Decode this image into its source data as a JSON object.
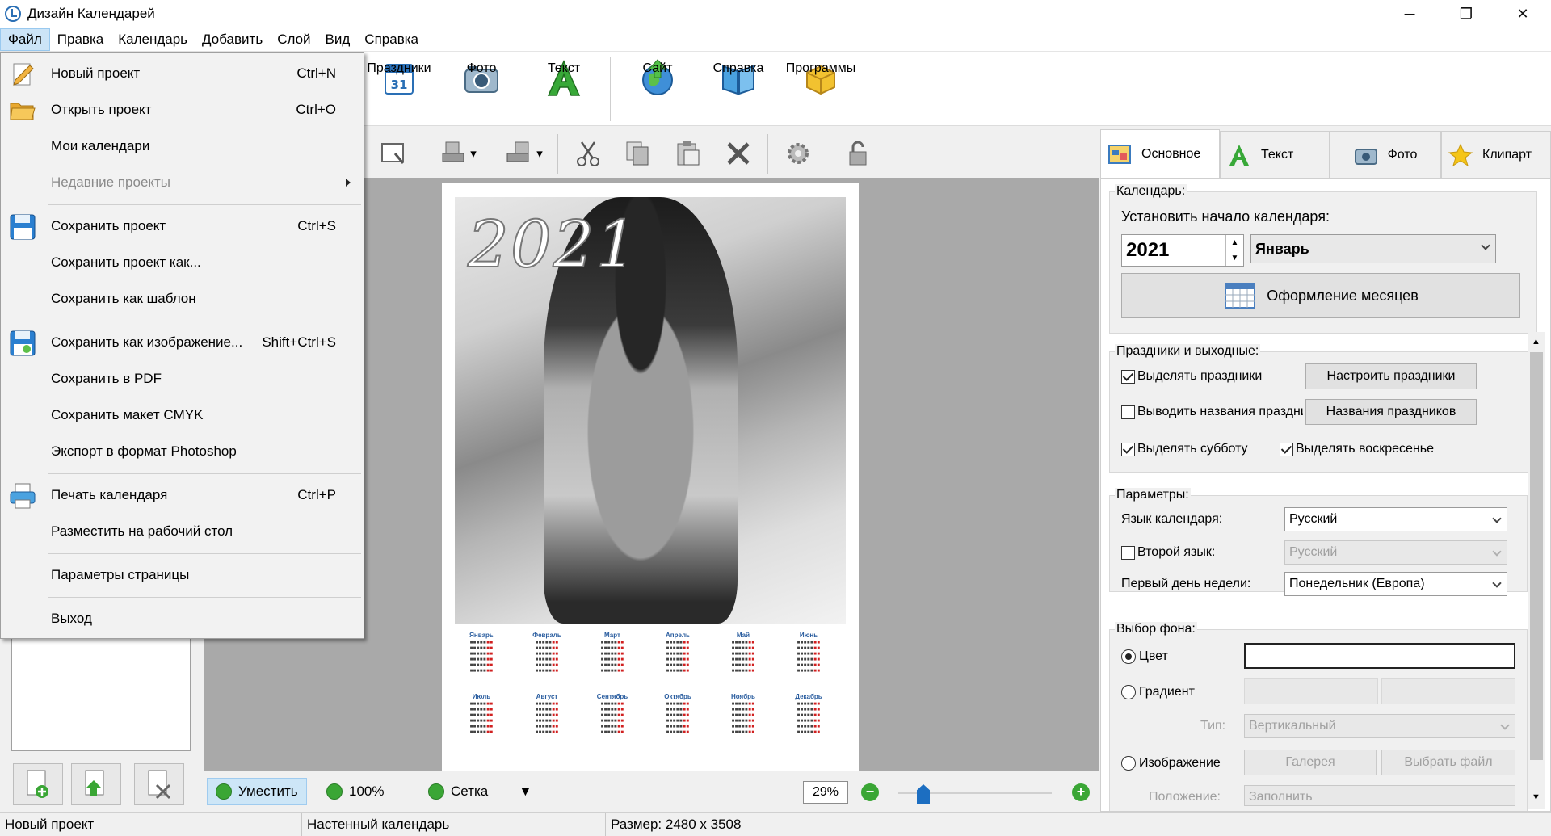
{
  "window": {
    "title": "Дизайн Календарей"
  },
  "menubar": [
    {
      "label": "Файл"
    },
    {
      "label": "Правка"
    },
    {
      "label": "Календарь"
    },
    {
      "label": "Добавить"
    },
    {
      "label": "Слой"
    },
    {
      "label": "Вид"
    },
    {
      "label": "Справка"
    }
  ],
  "toolbar": {
    "holidays": "Праздники",
    "photo": "Фото",
    "text": "Текст",
    "site": "Сайт",
    "help": "Справка",
    "programs": "Программы"
  },
  "file_menu": [
    {
      "label": "Новый проект",
      "shortcut": "Ctrl+N"
    },
    {
      "label": "Открыть проект",
      "shortcut": "Ctrl+O"
    },
    {
      "label": "Мои календари",
      "shortcut": ""
    },
    {
      "label": "Недавние проекты",
      "shortcut": ""
    },
    {
      "label": "Сохранить проект",
      "shortcut": "Ctrl+S"
    },
    {
      "label": "Сохранить проект как...",
      "shortcut": ""
    },
    {
      "label": "Сохранить как шаблон",
      "shortcut": ""
    },
    {
      "label": "Сохранить как изображение...",
      "shortcut": "Shift+Ctrl+S"
    },
    {
      "label": "Сохранить в PDF",
      "shortcut": ""
    },
    {
      "label": "Сохранить макет CMYK",
      "shortcut": ""
    },
    {
      "label": "Экспорт в формат Photoshop",
      "shortcut": ""
    },
    {
      "label": "Печать календаря",
      "shortcut": "Ctrl+P"
    },
    {
      "label": "Разместить на рабочий стол",
      "shortcut": ""
    },
    {
      "label": "Параметры страницы",
      "shortcut": ""
    },
    {
      "label": "Выход",
      "shortcut": ""
    }
  ],
  "canvas": {
    "year": "2021",
    "months": [
      "Январь",
      "Февраль",
      "Март",
      "Апрель",
      "Май",
      "Июнь",
      "Июль",
      "Август",
      "Сентябрь",
      "Октябрь",
      "Ноябрь",
      "Декабрь"
    ]
  },
  "bottom": {
    "fit": "Уместить",
    "hundred": "100%",
    "grid": "Сетка",
    "zoom": "29%"
  },
  "status": {
    "project": "Новый проект",
    "type": "Настенный календарь",
    "size": "Размер: 2480 x 3508"
  },
  "right_tabs": [
    {
      "label": "Основное"
    },
    {
      "label": "Текст"
    },
    {
      "label": "Фото"
    },
    {
      "label": "Клипарт"
    }
  ],
  "calendar_group": {
    "title": "Календарь:",
    "start_label": "Установить начало календаря:",
    "year": "2021",
    "month": "Январь",
    "design_button": "Оформление месяцев"
  },
  "holidays_group": {
    "title": "Праздники и выходные:",
    "highlight_holidays": "Выделять праздники",
    "show_names": "Выводить названия праздников",
    "highlight_saturday": "Выделять субботу",
    "highlight_sunday": "Выделять воскресенье",
    "setup_button": "Настроить праздники",
    "names_button": "Названия праздников"
  },
  "params_group": {
    "title": "Параметры:",
    "lang_label": "Язык календаря:",
    "lang_value": "Русский",
    "second_lang_label": "Второй язык:",
    "second_lang_value": "Русский",
    "first_day_label": "Первый день недели:",
    "first_day_value": "Понедельник (Европа)"
  },
  "background_group": {
    "title": "Выбор фона:",
    "color": "Цвет",
    "gradient": "Градиент",
    "type_label": "Тип:",
    "type_value": "Вертикальный",
    "image": "Изображение",
    "gallery_button": "Галерея",
    "choose_file_button": "Выбрать файл",
    "position_label": "Положение:",
    "position_value": "Заполнить"
  },
  "colors": {
    "accent": "#2a6fb5",
    "green": "#3aa635",
    "selection": "#cce4f7"
  }
}
